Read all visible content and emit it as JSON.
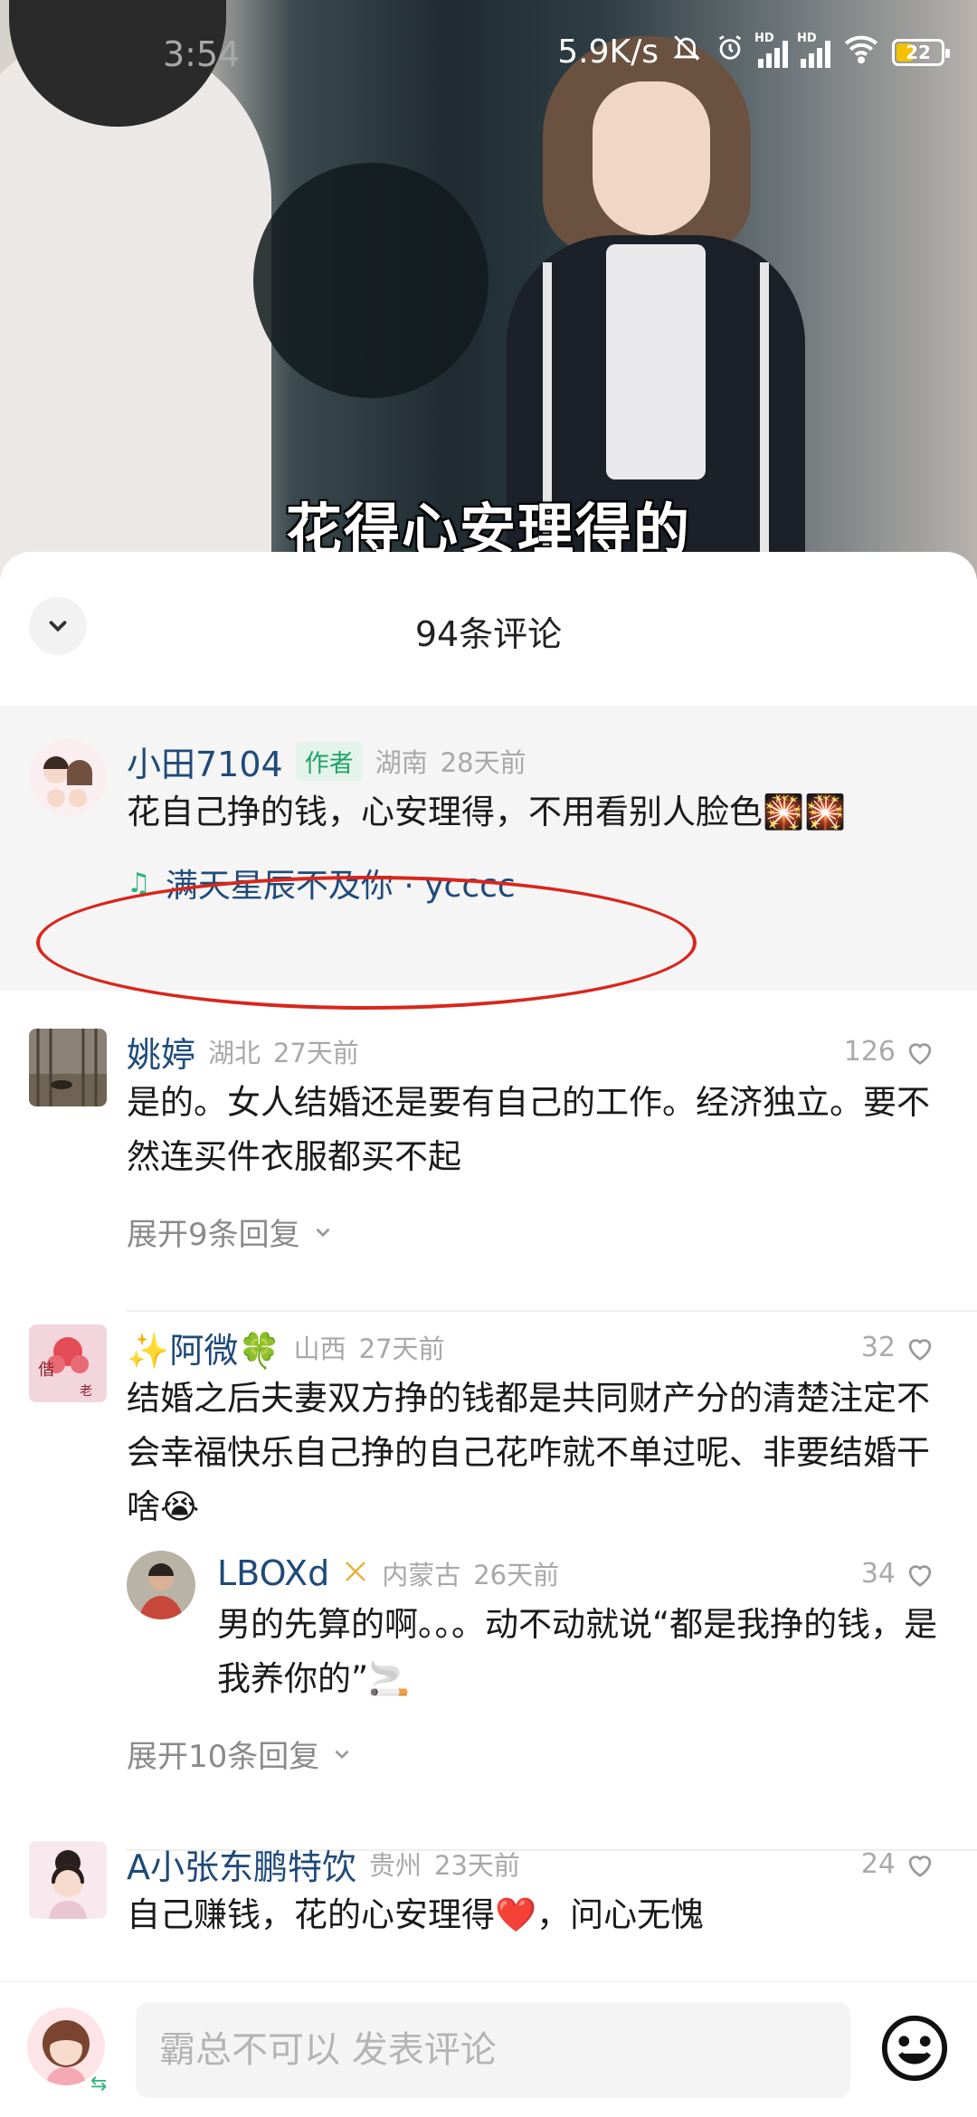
{
  "status_bar": {
    "time": "3:54",
    "net_speed": "5.9K/s",
    "signal_label_1": "HD",
    "signal_label_2": "HD",
    "battery": "22"
  },
  "video": {
    "subtitle": "花得心安理得的"
  },
  "comments_sheet": {
    "title": "94条评论",
    "pinned": {
      "username": "小田7104",
      "badge": "作者",
      "location": "湖南",
      "time": "28天前",
      "text": "花自己挣的钱，心安理得，不用看别人脸色🎇🎇",
      "music": "满天星辰不及你 · ycccc"
    },
    "comments": [
      {
        "username": "姚婷",
        "location": "湖北",
        "time": "27天前",
        "likes": "126",
        "text": "是的。女人结婚还是要有自己的工作。经济独立。要不然连买件衣服都买不起",
        "expand": "展开9条回复"
      },
      {
        "username": "✨阿微🍀",
        "location": "山西",
        "time": "27天前",
        "likes": "32",
        "text": "结婚之后夫妻双方挣的钱都是共同财产分的清楚注定不会幸福快乐自己挣的自己花咋就不单过呢、非要结婚干啥😭",
        "reply": {
          "username": "LBOXd",
          "location": "内蒙古",
          "time": "26天前",
          "likes": "34",
          "text": "男的先算的啊。。。动不动就说“都是我挣的钱，是我养你的”🚬"
        },
        "expand": "展开10条回复"
      },
      {
        "username": "A小张东鹏特饮",
        "location": "贵州",
        "time": "23天前",
        "likes": "24",
        "text": "自己赚钱，花的心安理得❤️，问心无愧"
      }
    ]
  },
  "input_bar": {
    "placeholder": "霸总不可以 发表评论"
  },
  "colors": {
    "username": "#1f4a7a",
    "author_badge": "#20a36a",
    "highlight_circle": "#d9261c"
  }
}
